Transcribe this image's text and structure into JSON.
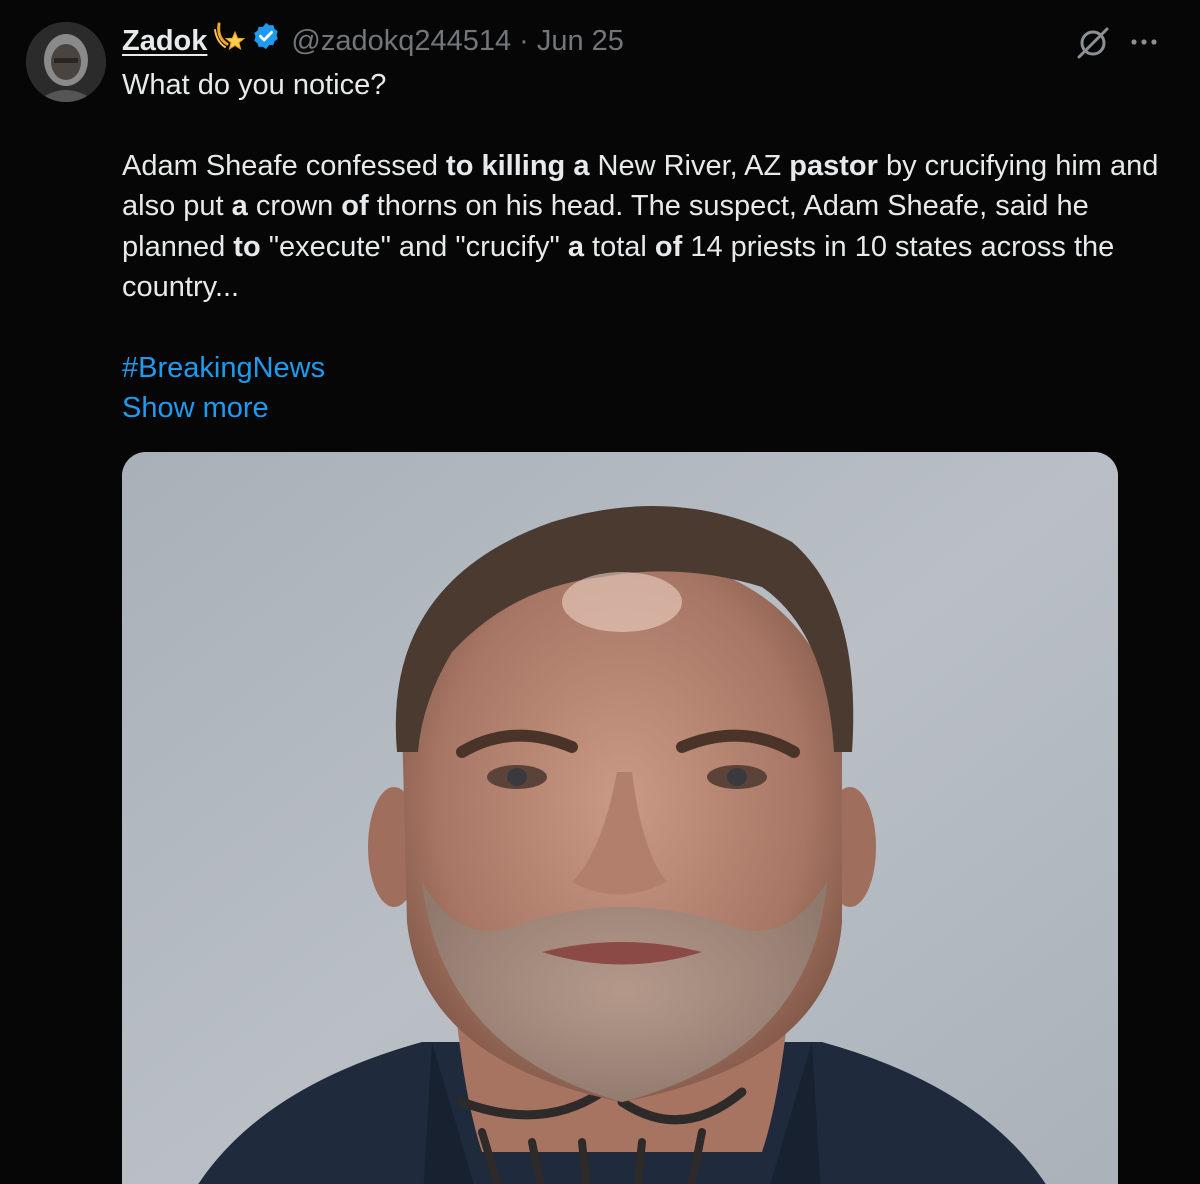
{
  "tweet": {
    "author": {
      "display_name": "Zadok",
      "handle": "@zadokq244514",
      "badge_icon": "shooting-star-emoji-icon",
      "verified_icon": "verified-badge-icon",
      "verified_color": "#1d9bf0"
    },
    "separator": "·",
    "date": "Jun 25",
    "header_actions": {
      "grok_icon": "grok-icon",
      "more_icon": "more-options-icon"
    },
    "lead": "What do you notice?",
    "body": {
      "s1": "Adam Sheafe confessed ",
      "b1": "to killing a",
      "s2": " New River, AZ ",
      "b2": "pastor",
      "s3": " by crucifying him and also put ",
      "b3": "a",
      "s4": " crown ",
      "b4": "of",
      "s5": " thorns on his head. The suspect, Adam Sheafe, said he planned ",
      "b5": "to",
      "s6": " \"execute\" and \"crucify\" ",
      "b6": "a",
      "s7": " total ",
      "b7": "of",
      "s8": " 14 priests in 10 states across the country..."
    },
    "hashtag": "#BreakingNews",
    "show_more": "Show more",
    "media": {
      "type": "photo",
      "subject": "mugshot"
    },
    "colors": {
      "background": "#060606",
      "text": "#e7e9ea",
      "secondary": "#71767b",
      "link": "#1d9bf0"
    }
  }
}
